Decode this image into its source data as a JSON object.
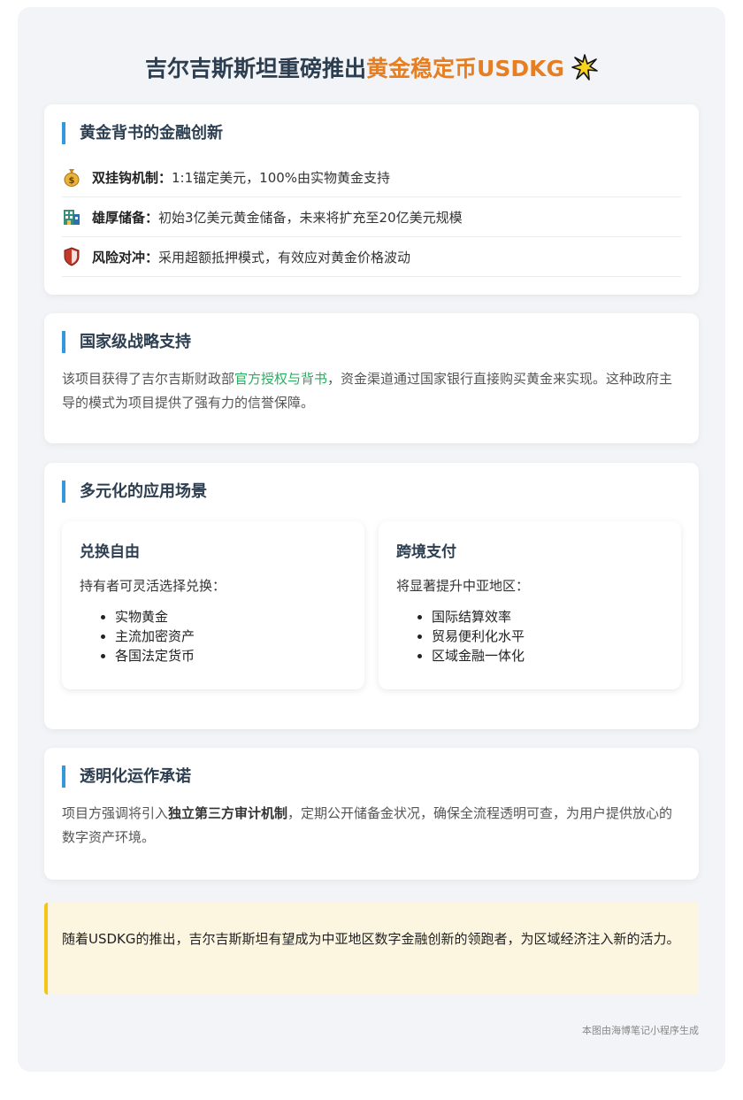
{
  "header": {
    "title_prefix": "吉尔吉斯斯坦重磅推出",
    "title_highlight": "黄金稳定币USDKG",
    "accent_color": "#e67e22"
  },
  "section_innovation": {
    "title": "黄金背书的金融创新",
    "items": [
      {
        "icon": "money-bag-icon",
        "label": "双挂钩机制：",
        "text": "1:1锚定美元，100%由实物黄金支持"
      },
      {
        "icon": "building-icon",
        "label": "雄厚储备：",
        "text": "初始3亿美元黄金储备，未来将扩充至20亿美元规模"
      },
      {
        "icon": "shield-icon",
        "label": "风险对冲：",
        "text": "采用超额抵押模式，有效应对黄金价格波动"
      }
    ]
  },
  "section_support": {
    "title": "国家级战略支持",
    "text_before": "该项目获得了吉尔吉斯财政部",
    "highlight": "官方授权与背书",
    "text_after": "，资金渠道通过国家银行直接购买黄金来实现。这种政府主导的模式为项目提供了强有力的信誉保障。"
  },
  "section_scenarios": {
    "title": "多元化的应用场景",
    "cards": [
      {
        "title": "兑换自由",
        "lead": "持有者可灵活选择兑换：",
        "items": [
          "实物黄金",
          "主流加密资产",
          "各国法定货币"
        ]
      },
      {
        "title": "跨境支付",
        "lead": "将显著提升中亚地区：",
        "items": [
          "国际结算效率",
          "贸易便利化水平",
          "区域金融一体化"
        ]
      }
    ]
  },
  "section_transparency": {
    "title": "透明化运作承诺",
    "text_before": "项目方强调将引入",
    "strong": "独立第三方审计机制",
    "text_after": "，定期公开储备金状况，确保全流程透明可查，为用户提供放心的数字资产环境。"
  },
  "conclusion": {
    "text": "随着USDKG的推出，吉尔吉斯斯坦有望成为中亚地区数字金融创新的领跑者，为区域经济注入新的活力。"
  },
  "footer": {
    "text": "本图由海博笔记小程序生成"
  }
}
